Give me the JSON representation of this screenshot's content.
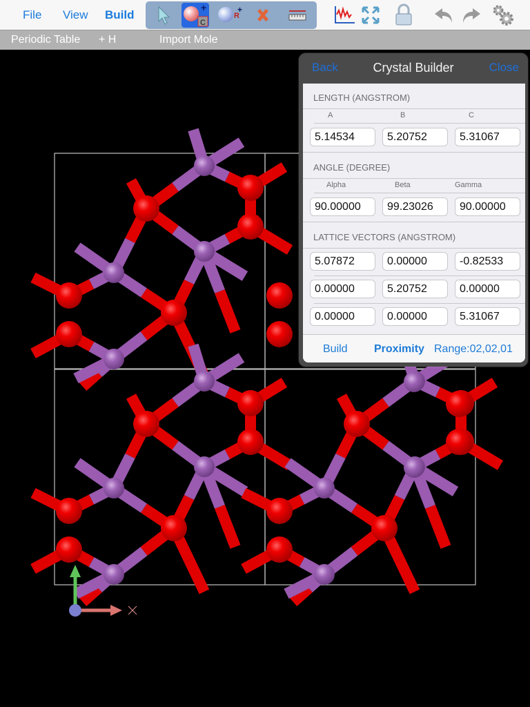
{
  "menubar": {
    "file": "File",
    "view": "View",
    "build": "Build"
  },
  "toolbar": {
    "tools": [
      {
        "name": "select-arrow-icon",
        "active": false
      },
      {
        "name": "add-atom-carbon-icon",
        "active": true,
        "element": "C"
      },
      {
        "name": "add-group-icon",
        "active": false,
        "badge": "R"
      },
      {
        "name": "delete-icon",
        "active": false
      },
      {
        "name": "measure-ruler-icon",
        "active": false
      }
    ],
    "right_tools": [
      "spectrum-chart-icon",
      "fit-to-screen-icon",
      "lock-icon",
      "undo-icon",
      "redo-icon",
      "settings-gears-icon"
    ]
  },
  "subbar": {
    "periodic_table": "Periodic Table",
    "add_h": "+ H",
    "import_mole": "Import Mole"
  },
  "crystal_builder": {
    "title": "Crystal Builder",
    "back": "Back",
    "close": "Close",
    "length_section": "LENGTH (ANGSTROM)",
    "length_labels": [
      "A",
      "B",
      "C"
    ],
    "length_values": [
      "5.14534",
      "5.20752",
      "5.31067"
    ],
    "angle_section": "ANGLE (DEGREE)",
    "angle_labels": [
      "Alpha",
      "Beta",
      "Gamma"
    ],
    "angle_values": [
      "90.00000",
      "99.23026",
      "90.00000"
    ],
    "lattice_section": "LATTICE VECTORS (ANGSTROM)",
    "lattice_vectors": [
      [
        "5.07872",
        "0.00000",
        "-0.82533"
      ],
      [
        "0.00000",
        "5.20752",
        "0.00000"
      ],
      [
        "0.00000",
        "0.00000",
        "5.31067"
      ]
    ],
    "footer": {
      "build": "Build",
      "proximity": "Proximity",
      "range": "Range:02,02,01"
    }
  },
  "viewer": {
    "colors": {
      "metal_atom": "#9a5bb0",
      "oxygen_atom": "#e00000",
      "cell_box": "#b5b5b5",
      "axis_x": "#d9746f",
      "axis_y": "#5fc45a",
      "axis_origin": "#7a7fcf"
    }
  }
}
